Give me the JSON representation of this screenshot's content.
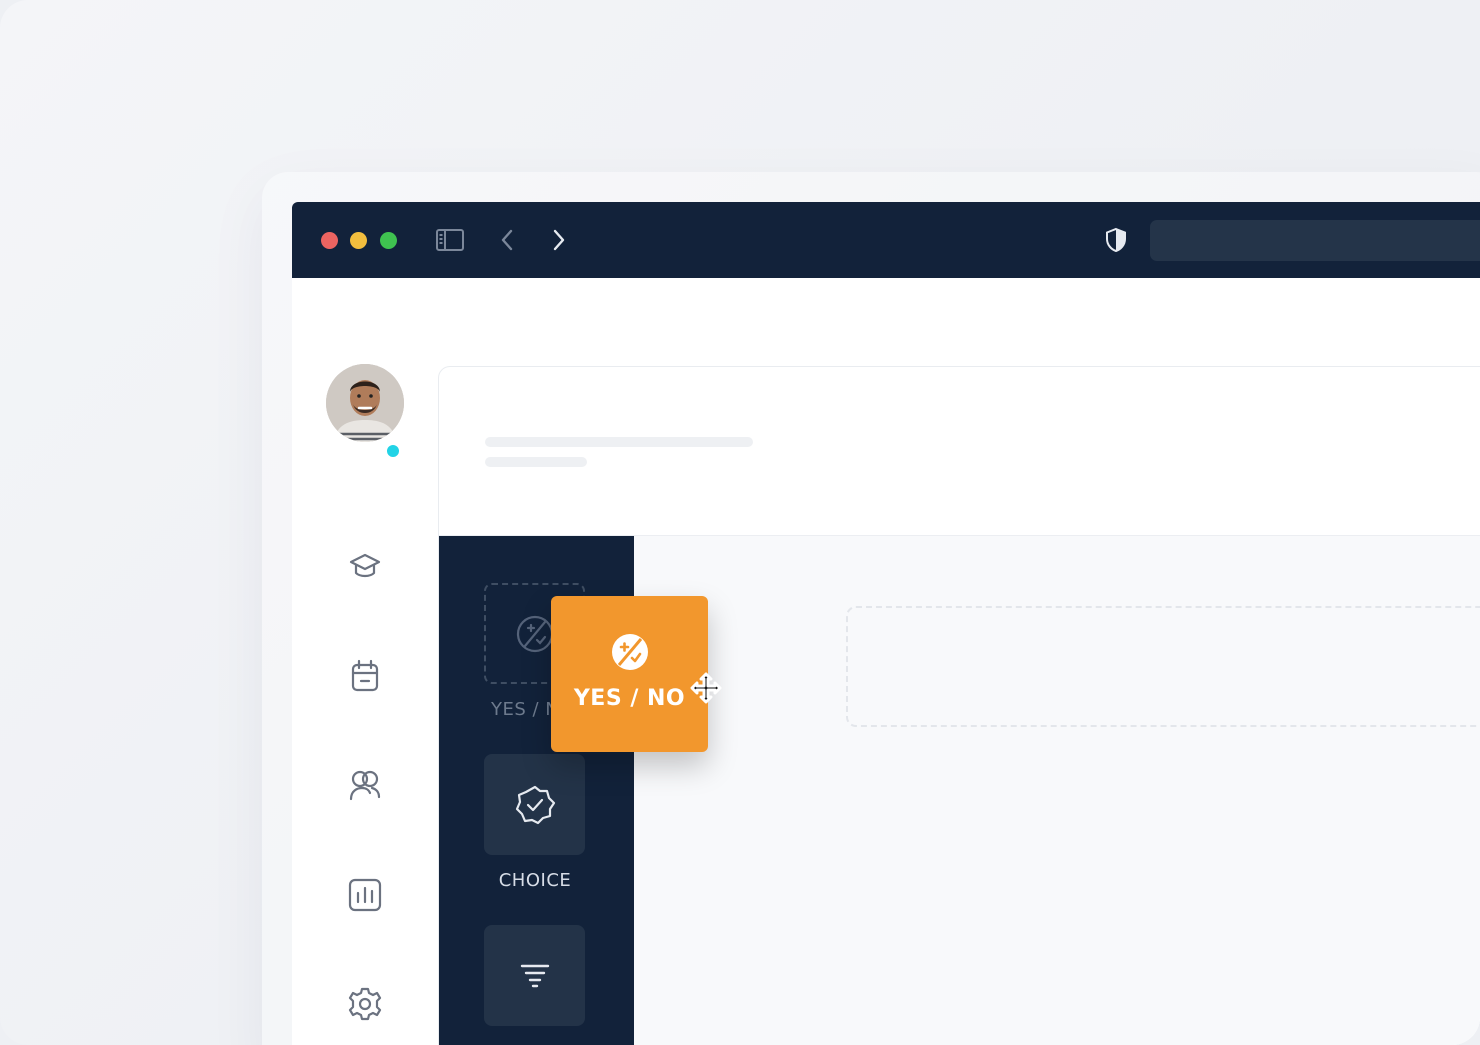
{
  "window": {
    "controls": [
      "close",
      "minimize",
      "maximize"
    ],
    "toolbar_icons": [
      "sidebar-toggle-icon",
      "back-arrow-icon",
      "forward-arrow-icon",
      "shield-icon"
    ]
  },
  "user": {
    "avatar": "avatar",
    "status": "online",
    "status_color": "#22d3e6"
  },
  "sidebar": {
    "items": [
      {
        "icon": "graduation-cap-icon"
      },
      {
        "icon": "calendar-icon"
      },
      {
        "icon": "users-icon"
      },
      {
        "icon": "bar-chart-icon"
      },
      {
        "icon": "gear-icon"
      }
    ]
  },
  "tools": {
    "items": [
      {
        "label": "YES / NO",
        "icon": "yes-no-icon",
        "state": "dragging-placeholder"
      },
      {
        "label": "CHOICE",
        "icon": "badge-check-icon"
      },
      {
        "label": "",
        "icon": "filter-lines-icon"
      }
    ],
    "faded_label": "YES / N"
  },
  "drag": {
    "label": "YES / NO",
    "icon": "yes-no-icon",
    "accent": "#f2972d"
  },
  "colors": {
    "titlebar": "#12223a",
    "panel": "#12223a",
    "accent": "#f2972d",
    "status": "#22d3e6"
  }
}
